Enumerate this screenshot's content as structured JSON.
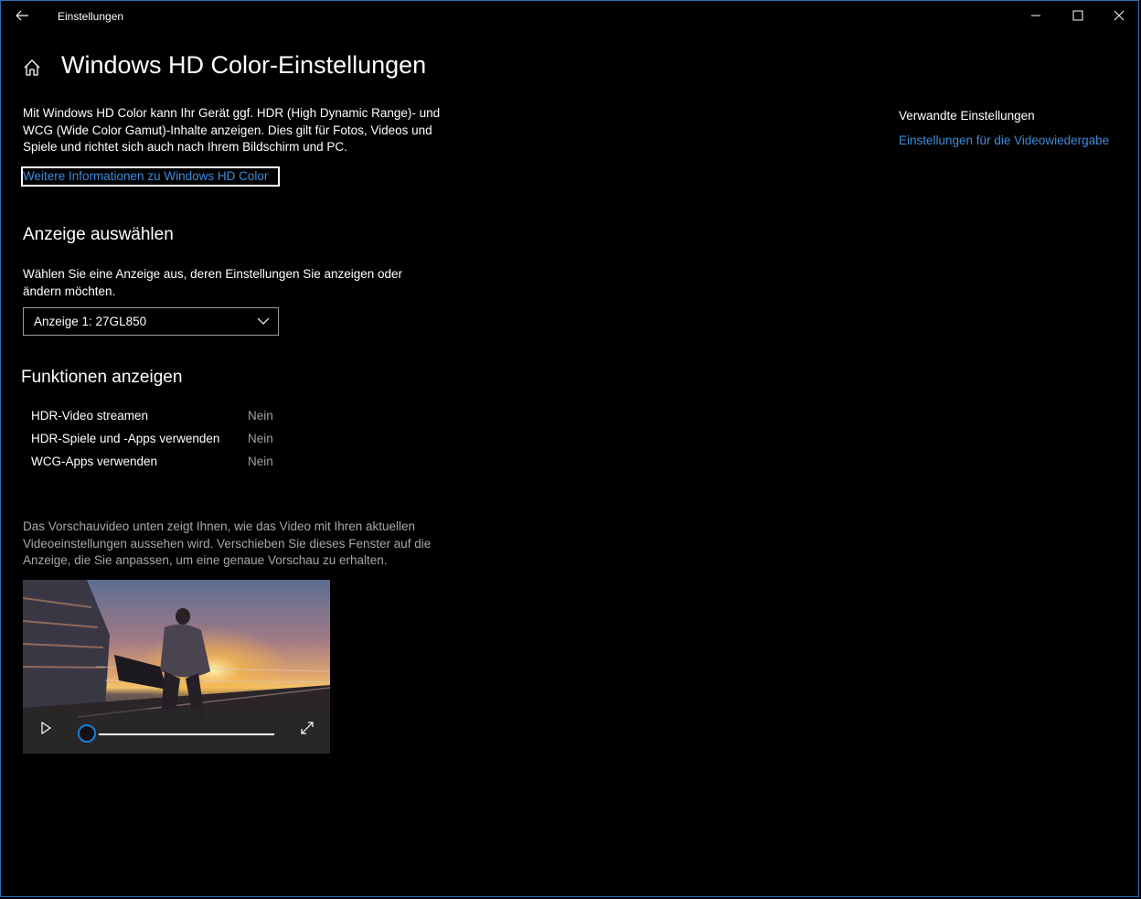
{
  "window": {
    "app_title": "Einstellungen"
  },
  "page": {
    "title": "Windows HD Color-Einstellungen",
    "intro": "Mit Windows HD Color kann Ihr Gerät ggf. HDR (High Dynamic Range)- und WCG (Wide Color Gamut)-Inhalte anzeigen. Dies gilt für Fotos, Videos und Spiele und richtet sich auch nach Ihrem Bildschirm und PC.",
    "info_link": "Weitere Informationen zu Windows HD Color"
  },
  "display_select": {
    "heading": "Anzeige auswählen",
    "description": "Wählen Sie eine Anzeige aus, deren Einstellungen Sie anzeigen oder ändern möchten.",
    "selected": "Anzeige 1: 27GL850"
  },
  "features": {
    "heading": "Funktionen anzeigen",
    "rows": [
      {
        "name": "HDR-Video streamen",
        "value": "Nein"
      },
      {
        "name": "HDR-Spiele und -Apps verwenden",
        "value": "Nein"
      },
      {
        "name": "WCG-Apps verwenden",
        "value": "Nein"
      }
    ]
  },
  "preview": {
    "description": "Das Vorschauvideo unten zeigt Ihnen, wie das Video mit Ihren aktuellen Videoeinstellungen aussehen wird. Verschieben Sie dieses Fenster auf die Anzeige, die Sie anpassen, um eine genaue Vorschau zu erhalten.",
    "progress": 0
  },
  "related": {
    "title": "Verwandte Einstellungen",
    "link": "Einstellungen für die Videowiedergabe"
  },
  "colors": {
    "background": "#000000",
    "link": "#3c8bdc",
    "accent": "#1a7fd6",
    "secondary_text": "#a0a0a0"
  }
}
